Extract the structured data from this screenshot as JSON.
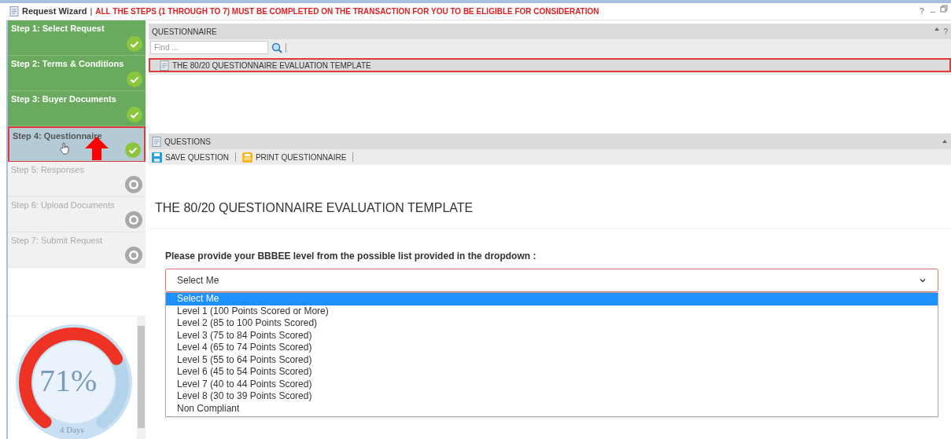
{
  "window": {
    "title": "Request Wizard",
    "separator": "|",
    "notice": "ALL THE STEPS (1 THROUGH TO 7) MUST BE COMPLETED ON THE TRANSACTION FOR YOU TO BE ELIGIBLE FOR CONSIDERATION",
    "controls": [
      "?",
      "–"
    ]
  },
  "steps": [
    {
      "label": "Step 1: Select Request",
      "completed": true,
      "selected": false
    },
    {
      "label": "Step 2: Terms & Conditions",
      "completed": true,
      "selected": false
    },
    {
      "label": "Step 3: Buyer Documents",
      "completed": true,
      "selected": false
    },
    {
      "label": "Step 4: Questionnaire",
      "completed": true,
      "selected": true
    },
    {
      "label": "Step 5: Responses",
      "completed": false,
      "selected": false
    },
    {
      "label": "Step 6: Upload Documents",
      "completed": false,
      "selected": false
    },
    {
      "label": "Step 7: Submit Request",
      "completed": false,
      "selected": false
    }
  ],
  "progress": {
    "percent": "71%",
    "level": 0.71,
    "caption": "4 Days"
  },
  "questionnaire_panel": {
    "title": "QUESTIONNAIRE",
    "controls": [
      "?"
    ],
    "search": {
      "placeholder": "Find ..."
    },
    "items": [
      {
        "label": "THE 80/20 QUESTIONNAIRE EVALUATION TEMPLATE",
        "selected": true
      }
    ]
  },
  "questions_panel": {
    "title": "QUESTIONS",
    "toolbar": [
      "SAVE QUESTION",
      "PRINT QUESTIONNAIRE"
    ],
    "heading": "THE 80/20 QUESTIONNAIRE EVALUATION TEMPLATE",
    "question": "Please provide your **BBBEE** level from the possible list provided in the dropdown :",
    "select": {
      "value": "Select Me",
      "expanded": true,
      "options": [
        {
          "label": "Select Me",
          "selected": true
        },
        {
          "label": "Level 1 (100 Points Scored or More)",
          "selected": false
        },
        {
          "label": "Level 2 (85 to 100 Points Scored)",
          "selected": false
        },
        {
          "label": "Level 3 (75 to 84 Points Scored)",
          "selected": false
        },
        {
          "label": "Level 4 (65 to 74 Points Scored)",
          "selected": false
        },
        {
          "label": "Level 5 (55 to 64 Points Scored)",
          "selected": false
        },
        {
          "label": "Level 6 (45 to 54 Points Scored)",
          "selected": false
        },
        {
          "label": "Level 7 (40 to 44 Points Scored)",
          "selected": false
        },
        {
          "label": "Level 8 (30 to 39 Points Scored)",
          "selected": false
        },
        {
          "label": "Non Compliant",
          "selected": false
        }
      ]
    }
  }
}
